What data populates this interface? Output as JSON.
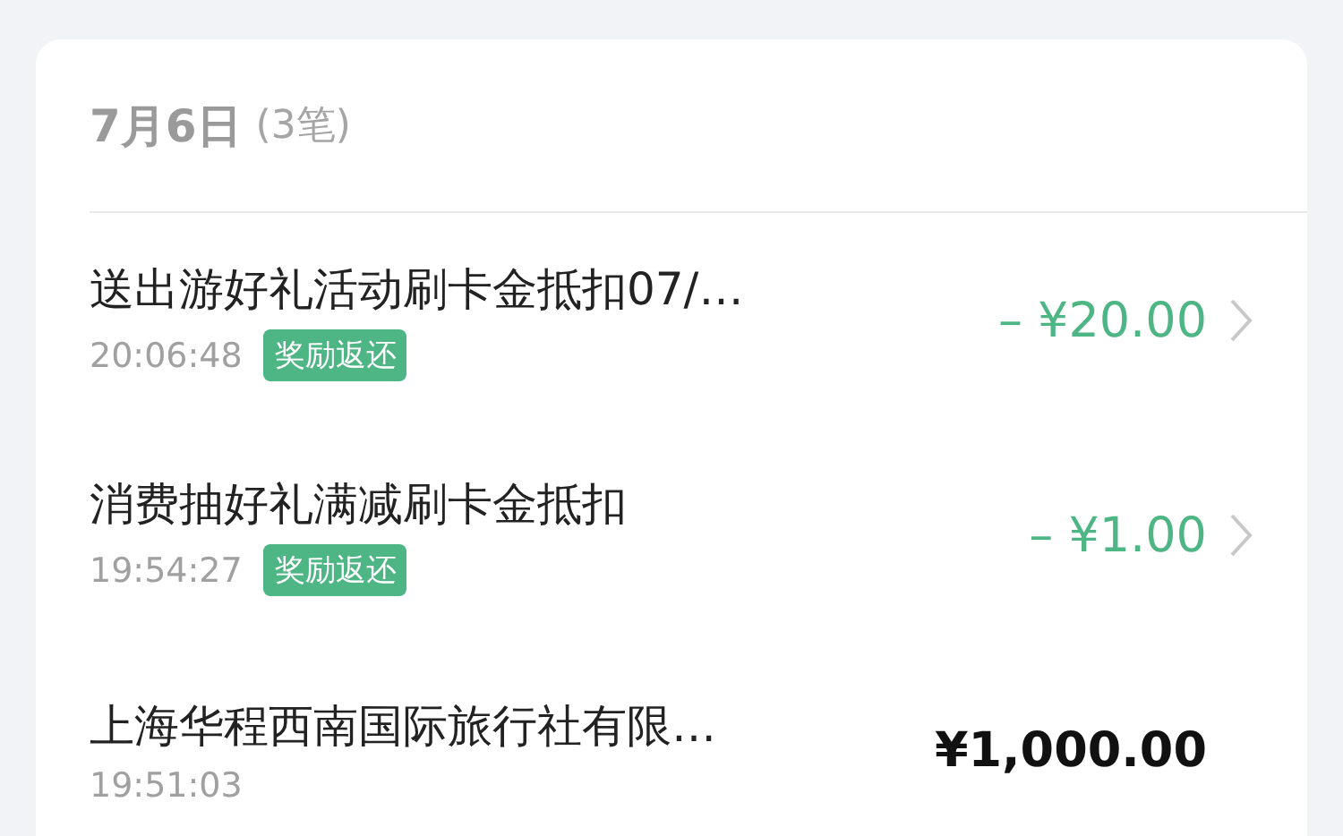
{
  "date_header": {
    "date": "7月6日",
    "count": "(3笔)"
  },
  "transactions": [
    {
      "title": "送出游好礼活动刷卡金抵扣07/…",
      "time": "20:06:48",
      "tag": "奖励返还",
      "amount": "– ¥20.00",
      "kind": "refund",
      "has_detail": true
    },
    {
      "title": "消费抽好礼满减刷卡金抵扣",
      "time": "19:54:27",
      "tag": "奖励返还",
      "amount": "– ¥1.00",
      "kind": "refund",
      "has_detail": true
    },
    {
      "title": "上海华程西南国际旅行社有限…",
      "time": "19:51:03",
      "amount": "¥1,000.00",
      "kind": "payment",
      "has_detail": false
    }
  ]
}
